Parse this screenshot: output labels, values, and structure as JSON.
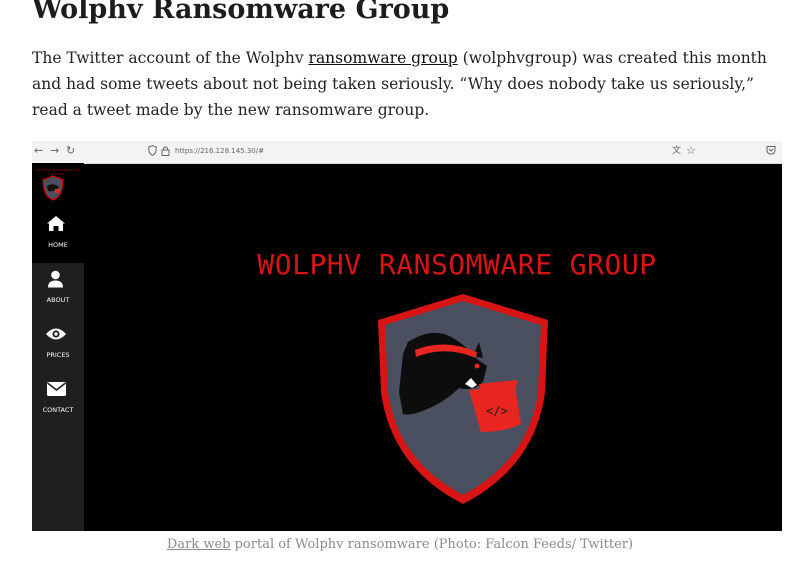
{
  "article": {
    "heading": "Wolphv Ransomware Group",
    "intro_before_link": "The Twitter account of the Wolphv ",
    "intro_link": "ransomware group",
    "intro_after_link": " (wolphvgroup) was created this month and had some tweets about not being taken seriously. “Why does nobody take us seriously,” read a tweet made by the new ransomware group."
  },
  "screenshot": {
    "browser": {
      "url": "https://216.128.145.30/#",
      "icons": [
        "back-arrow-icon",
        "forward-arrow-icon",
        "reload-icon",
        "shield-icon",
        "lock-icon",
        "translate-icon",
        "star-icon",
        "pocket-icon"
      ]
    },
    "sidebar": {
      "brand_text": "WOLPHV RANSOMWARE GROUP",
      "items": [
        {
          "label": "HOME",
          "icon": "home-icon"
        },
        {
          "label": "ABOUT",
          "icon": "user-icon"
        },
        {
          "label": "PRICES",
          "icon": "eye-icon"
        },
        {
          "label": "CONTACT",
          "icon": "envelope-icon"
        }
      ]
    },
    "banner_title": "WOLPHV RANSOMWARE GROUP",
    "logo": {
      "icon": "wolf-shield-logo",
      "flag_text": "</>",
      "colors": {
        "shield": "#4a5060",
        "border": "#d81414",
        "accent": "#e8261f"
      }
    }
  },
  "caption": {
    "link": "Dark web",
    "rest": " portal of Wolphv ransomware (Photo: Falcon Feeds/ Twitter)"
  }
}
